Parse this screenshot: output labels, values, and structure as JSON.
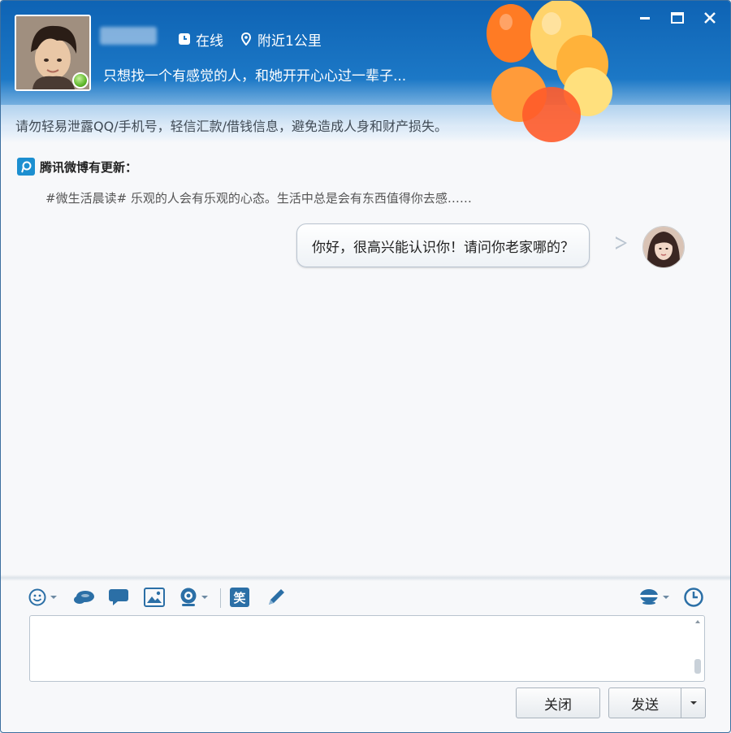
{
  "window": {
    "controls": {
      "minimize": "minimize-icon",
      "maximize": "maximize-icon",
      "close": "close-icon"
    }
  },
  "contact": {
    "status": "在线",
    "distance": "附近1公里",
    "signature": "只想找一个有感觉的人，和她开开心心过一辈子...",
    "online_color": "#5fb82c"
  },
  "warning": "请勿轻易泄露QQ/手机号，轻信汇款/借钱信息，避免造成人身和财产损失。",
  "weibo": {
    "title": "腾讯微博有更新：",
    "text": "#微生活晨读# 乐观的人会有乐观的心态。生活中总是会有东西值得你去感……"
  },
  "messages": [
    {
      "from": "me",
      "text": "你好，很高兴能认识你！请问你老家哪的？"
    }
  ],
  "toolbar": {
    "icons": [
      "emoji-icon",
      "magic-expression-icon",
      "chat-bubble-icon",
      "screenshot-icon",
      "webcam-icon",
      "funny-text-icon",
      "doodle-pen-icon",
      "voice-call-icon",
      "history-icon"
    ],
    "funny_label": "笑"
  },
  "input": {
    "value": ""
  },
  "buttons": {
    "close_label": "关闭",
    "send_label": "发送"
  },
  "colors": {
    "header_blue": "#0e63b4",
    "accent": "#1c78c6",
    "icon_blue": "#2b6fa6"
  }
}
